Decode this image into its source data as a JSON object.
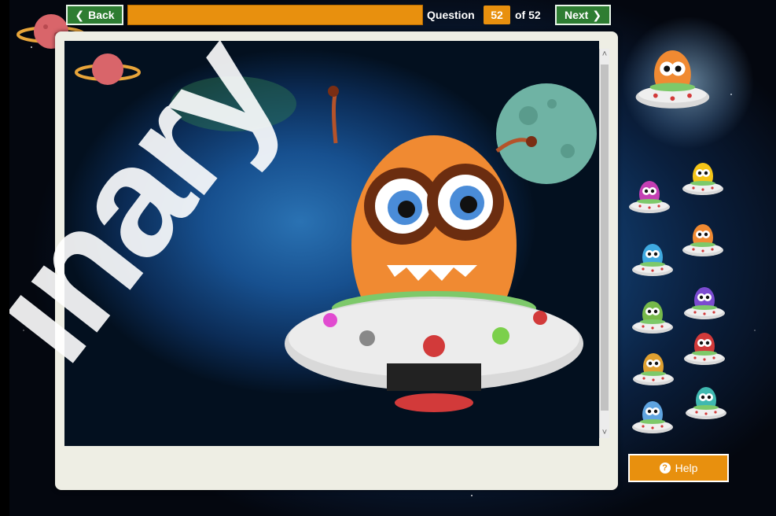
{
  "nav": {
    "back_label": "Back",
    "next_label": "Next",
    "question_label": "Question",
    "current_question": "52",
    "of_label": "of 52"
  },
  "progress": {
    "fraction": 1.0
  },
  "help": {
    "label": "Help"
  },
  "watermark": {
    "text": "inary"
  },
  "thumbnails": [
    {
      "name": "alien-orange-big"
    },
    {
      "name": "alien-purple"
    },
    {
      "name": "alien-yellow-robot"
    },
    {
      "name": "alien-blue"
    },
    {
      "name": "alien-orange-small"
    },
    {
      "name": "alien-green"
    },
    {
      "name": "alien-purple-small"
    },
    {
      "name": "alien-yellow-goggles"
    },
    {
      "name": "alien-red"
    },
    {
      "name": "alien-blue-small"
    },
    {
      "name": "alien-teal"
    }
  ],
  "colors": {
    "accent": "#e8900e",
    "nav_green": "#2e7d32"
  }
}
